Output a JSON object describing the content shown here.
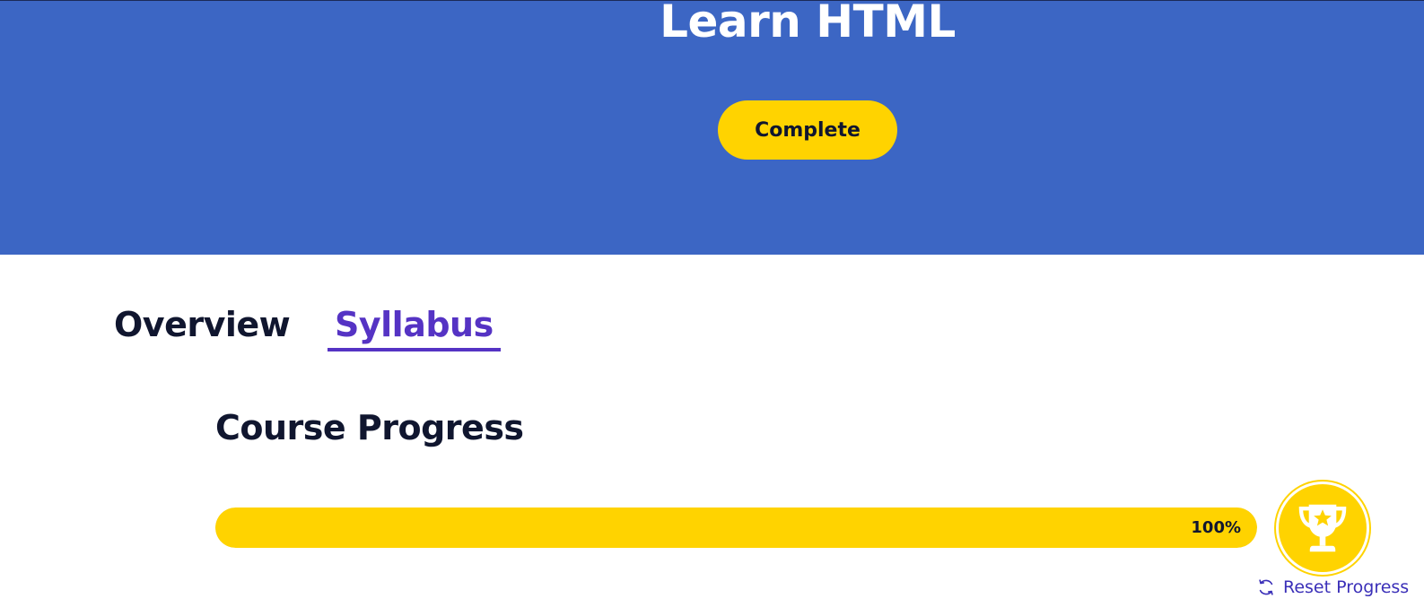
{
  "hero": {
    "title": "Learn HTML",
    "complete_button_label": "Complete"
  },
  "tabs": [
    {
      "label": "Overview",
      "active": false
    },
    {
      "label": "Syllabus",
      "active": true
    }
  ],
  "progress": {
    "heading": "Course Progress",
    "percent_value": 100,
    "percent_label": "100%",
    "reset_label": "Reset Progress",
    "trophy_icon": "trophy-icon",
    "reset_icon": "refresh-icon"
  },
  "colors": {
    "hero_background": "#3c66c4",
    "accent_yellow": "#ffd300",
    "active_tab": "#5533c4",
    "text_dark": "#10162f",
    "link": "#3a2fb8"
  }
}
